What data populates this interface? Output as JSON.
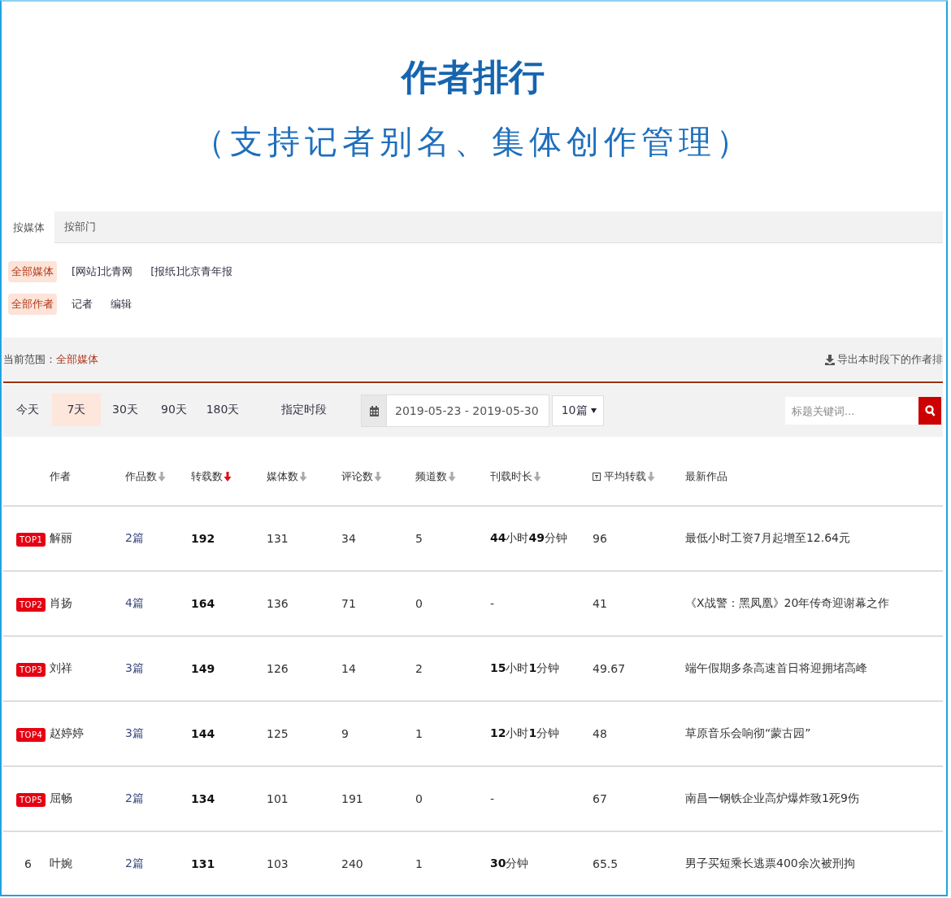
{
  "header": {
    "title": "作者排行",
    "subtitle": "（支持记者别名、集体创作管理）"
  },
  "tabs": [
    {
      "label": "按媒体",
      "selected": true
    },
    {
      "label": "按部门",
      "selected": false
    }
  ],
  "filters": [
    {
      "items": [
        {
          "label": "全部媒体",
          "selected": true
        },
        {
          "label": "[网站]北青网",
          "selected": false
        },
        {
          "label": "[报纸]北京青年报",
          "selected": false
        }
      ]
    },
    {
      "items": [
        {
          "label": "全部作者",
          "selected": true
        },
        {
          "label": "记者",
          "selected": false
        },
        {
          "label": "编辑",
          "selected": false
        }
      ]
    }
  ],
  "scope": {
    "label": "当前范围：",
    "value": "全部媒体"
  },
  "export": {
    "label": "导出本时段下的作者排"
  },
  "periods": [
    {
      "label": "今天",
      "selected": false
    },
    {
      "label": "7天",
      "selected": true
    },
    {
      "label": "30天",
      "selected": false
    },
    {
      "label": "90天",
      "selected": false
    },
    {
      "label": "180天",
      "selected": false
    },
    {
      "label": "指定时段",
      "selected": false
    }
  ],
  "date_range": {
    "value": "2019-05-23 - 2019-05-30"
  },
  "page_size": {
    "value": "10篇"
  },
  "search": {
    "placeholder": "标题关键词..."
  },
  "table": {
    "columns": [
      {
        "label": "作者",
        "kind": "plain"
      },
      {
        "label": "作品数",
        "kind": "sortable",
        "sorted": false
      },
      {
        "label": "转载数",
        "kind": "sortable",
        "sorted": true
      },
      {
        "label": "媒体数",
        "kind": "sortable",
        "sorted": false
      },
      {
        "label": "评论数",
        "kind": "sortable",
        "sorted": false
      },
      {
        "label": "频道数",
        "kind": "sortable",
        "sorted": false
      },
      {
        "label": "刊载时长",
        "kind": "sortable",
        "sorted": false
      },
      {
        "label": "平均转载",
        "kind": "sortable",
        "sorted": false,
        "info_icon": true
      },
      {
        "label": "最新作品",
        "kind": "plain"
      }
    ],
    "rows": [
      {
        "rank": "TOP1",
        "kind": "badge",
        "author": "解丽",
        "works": "2篇",
        "reprints": "192",
        "media": "131",
        "comments": "34",
        "channels": "5",
        "duration": "**44**小时**49**分钟",
        "avg": "96",
        "latest": "最低小时工资7月起增至12.64元"
      },
      {
        "rank": "TOP2",
        "kind": "badge",
        "author": "肖扬",
        "works": "4篇",
        "reprints": "164",
        "media": "136",
        "comments": "71",
        "channels": "0",
        "duration": "-",
        "avg": "41",
        "latest": "《X战警：黑凤凰》20年传奇迎谢幕之作"
      },
      {
        "rank": "TOP3",
        "kind": "badge",
        "author": "刘祥",
        "works": "3篇",
        "reprints": "149",
        "media": "126",
        "comments": "14",
        "channels": "2",
        "duration": "**15**小时**1**分钟",
        "avg": "49.67",
        "latest": "端午假期多条高速首日将迎拥堵高峰"
      },
      {
        "rank": "TOP4",
        "kind": "badge",
        "author": "赵婷婷",
        "works": "3篇",
        "reprints": "144",
        "media": "125",
        "comments": "9",
        "channels": "1",
        "duration": "**12**小时**1**分钟",
        "avg": "48",
        "latest": "草原音乐会响彻“蒙古园”"
      },
      {
        "rank": "TOP5",
        "kind": "badge",
        "author": "屈畅",
        "works": "2篇",
        "reprints": "134",
        "media": "101",
        "comments": "191",
        "channels": "0",
        "duration": "-",
        "avg": "67",
        "latest": "南昌一钢铁企业高炉爆炸致1死9伤"
      },
      {
        "rank": "6",
        "kind": "plain",
        "author": "叶婉",
        "works": "2篇",
        "reprints": "131",
        "media": "103",
        "comments": "240",
        "channels": "1",
        "duration": "**30**分钟",
        "avg": "65.5",
        "latest": "男子买短乘长逃票400余次被刑拘"
      }
    ]
  }
}
